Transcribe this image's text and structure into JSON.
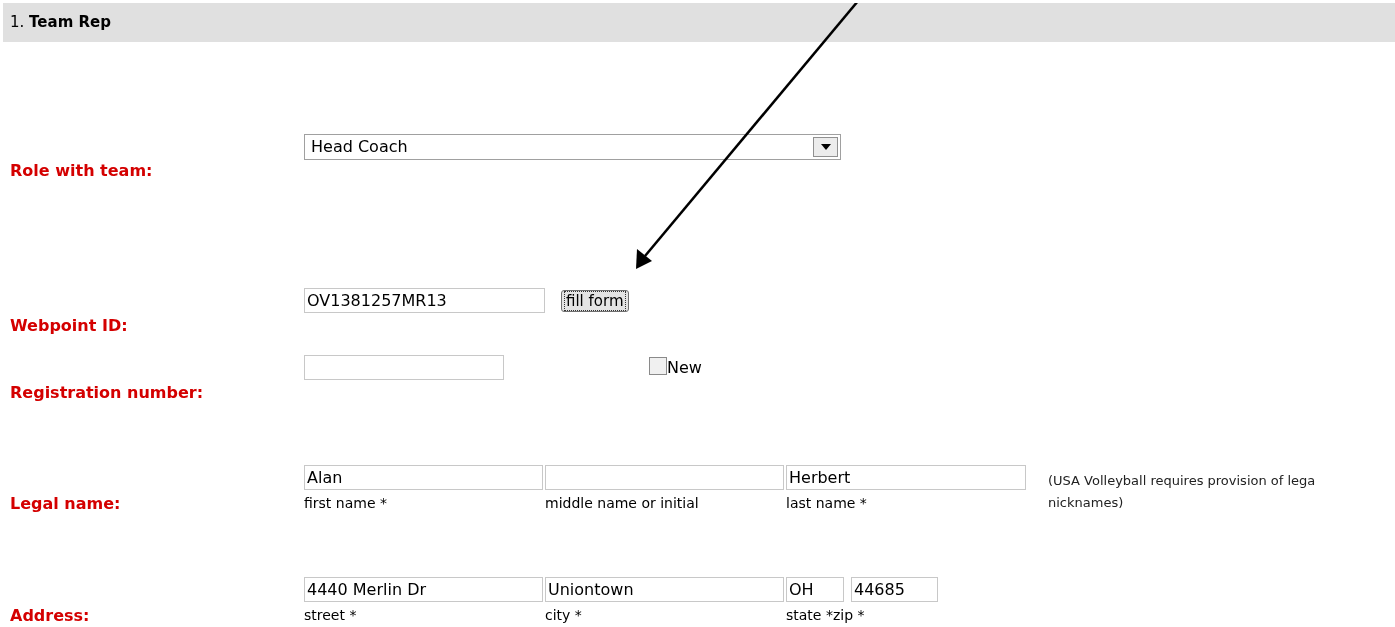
{
  "section": {
    "title": "1. **Team Rep**"
  },
  "fields": [
    {
      "kind": "select",
      "label": "Role with team:",
      "value": "Head Coach"
    },
    {
      "kind": "lookup",
      "label": "Webpoint ID:",
      "value": "OV1381257MR13",
      "button": "fill form"
    },
    {
      "kind": "registration",
      "label": "Registration number:",
      "checkbox": {
        "label": "New",
        "checked": false
      }
    },
    {
      "kind": "name",
      "label": "Legal name:",
      "parts": [
        {
          "value": "Alan",
          "caption": "first name *"
        },
        {
          "caption": "middle name or initial"
        },
        {
          "value": "Herbert",
          "caption": "last name *"
        }
      ],
      "note": [
        "(USA Volleyball requires provision of lega",
        "nicknames)"
      ]
    },
    {
      "kind": "address",
      "label": "Address:",
      "parts": [
        {
          "value": "4440 Merlin Dr",
          "caption": "street *"
        },
        {
          "value": "Uniontown",
          "caption": "city *"
        },
        {
          "value": "OH",
          "caption": "state *"
        },
        {
          "value": "44685",
          "caption": "zip *"
        }
      ]
    }
  ]
}
